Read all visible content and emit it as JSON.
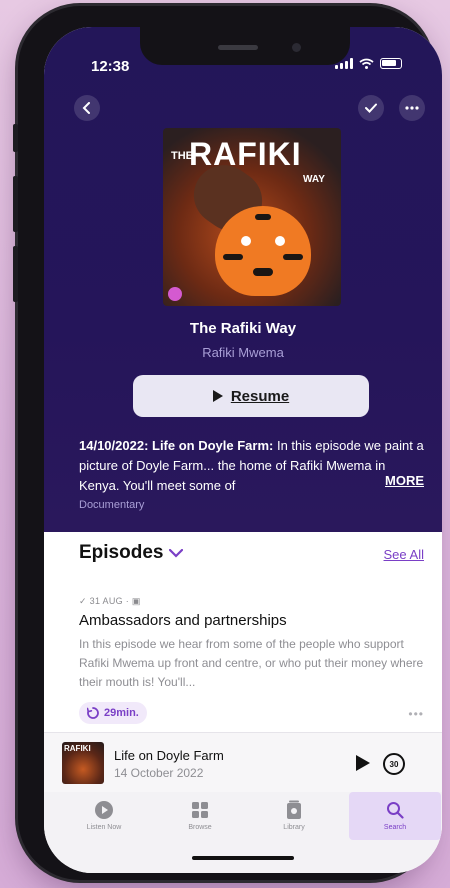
{
  "status_bar": {
    "time": "12:38"
  },
  "header": {
    "back_icon": "chevron-left-icon",
    "check_icon": "checkmark-icon",
    "more_icon": "ellipsis-icon"
  },
  "podcast": {
    "artwork_lettering": {
      "the": "THE",
      "rafiki": "RAFIKI",
      "way": "WAY"
    },
    "title": "The Rafiki Way",
    "author": "Rafiki Mwema",
    "resume_label": "Resume",
    "description_bold": "14/10/2022: Life on Doyle Farm:",
    "description_rest": " In this episode we paint a picture of Doyle Farm... the home of Rafiki Mwema in Kenya. You'll meet some of",
    "more_label": "MORE",
    "genre": "Documentary"
  },
  "episodes": {
    "heading": "Episodes",
    "see_all_label": "See All",
    "items": [
      {
        "meta": "✓ 31 AUG · ▣",
        "title": "Ambassadors and partnerships",
        "description": "In this episode we hear from some of the people who support Rafiki Mwema up front and centre, or who put their money where their mouth is! You'll...",
        "duration": "29min.",
        "more": "•••"
      }
    ]
  },
  "mini_player": {
    "artwork_lettering": "RAFIKI",
    "title": "Life on Doyle Farm",
    "date": "14 October 2022",
    "skip_label": "30"
  },
  "tabbar": {
    "items": [
      {
        "label": "Listen Now",
        "icon": "play-circle-icon"
      },
      {
        "label": "Browse",
        "icon": "grid-icon"
      },
      {
        "label": "Library",
        "icon": "library-icon"
      },
      {
        "label": "Search",
        "icon": "search-icon"
      }
    ],
    "active_index": 3
  },
  "colors": {
    "hero_background": "#25155a",
    "accent": "#7a3fc6",
    "secondary_text": "#a99fd6"
  }
}
